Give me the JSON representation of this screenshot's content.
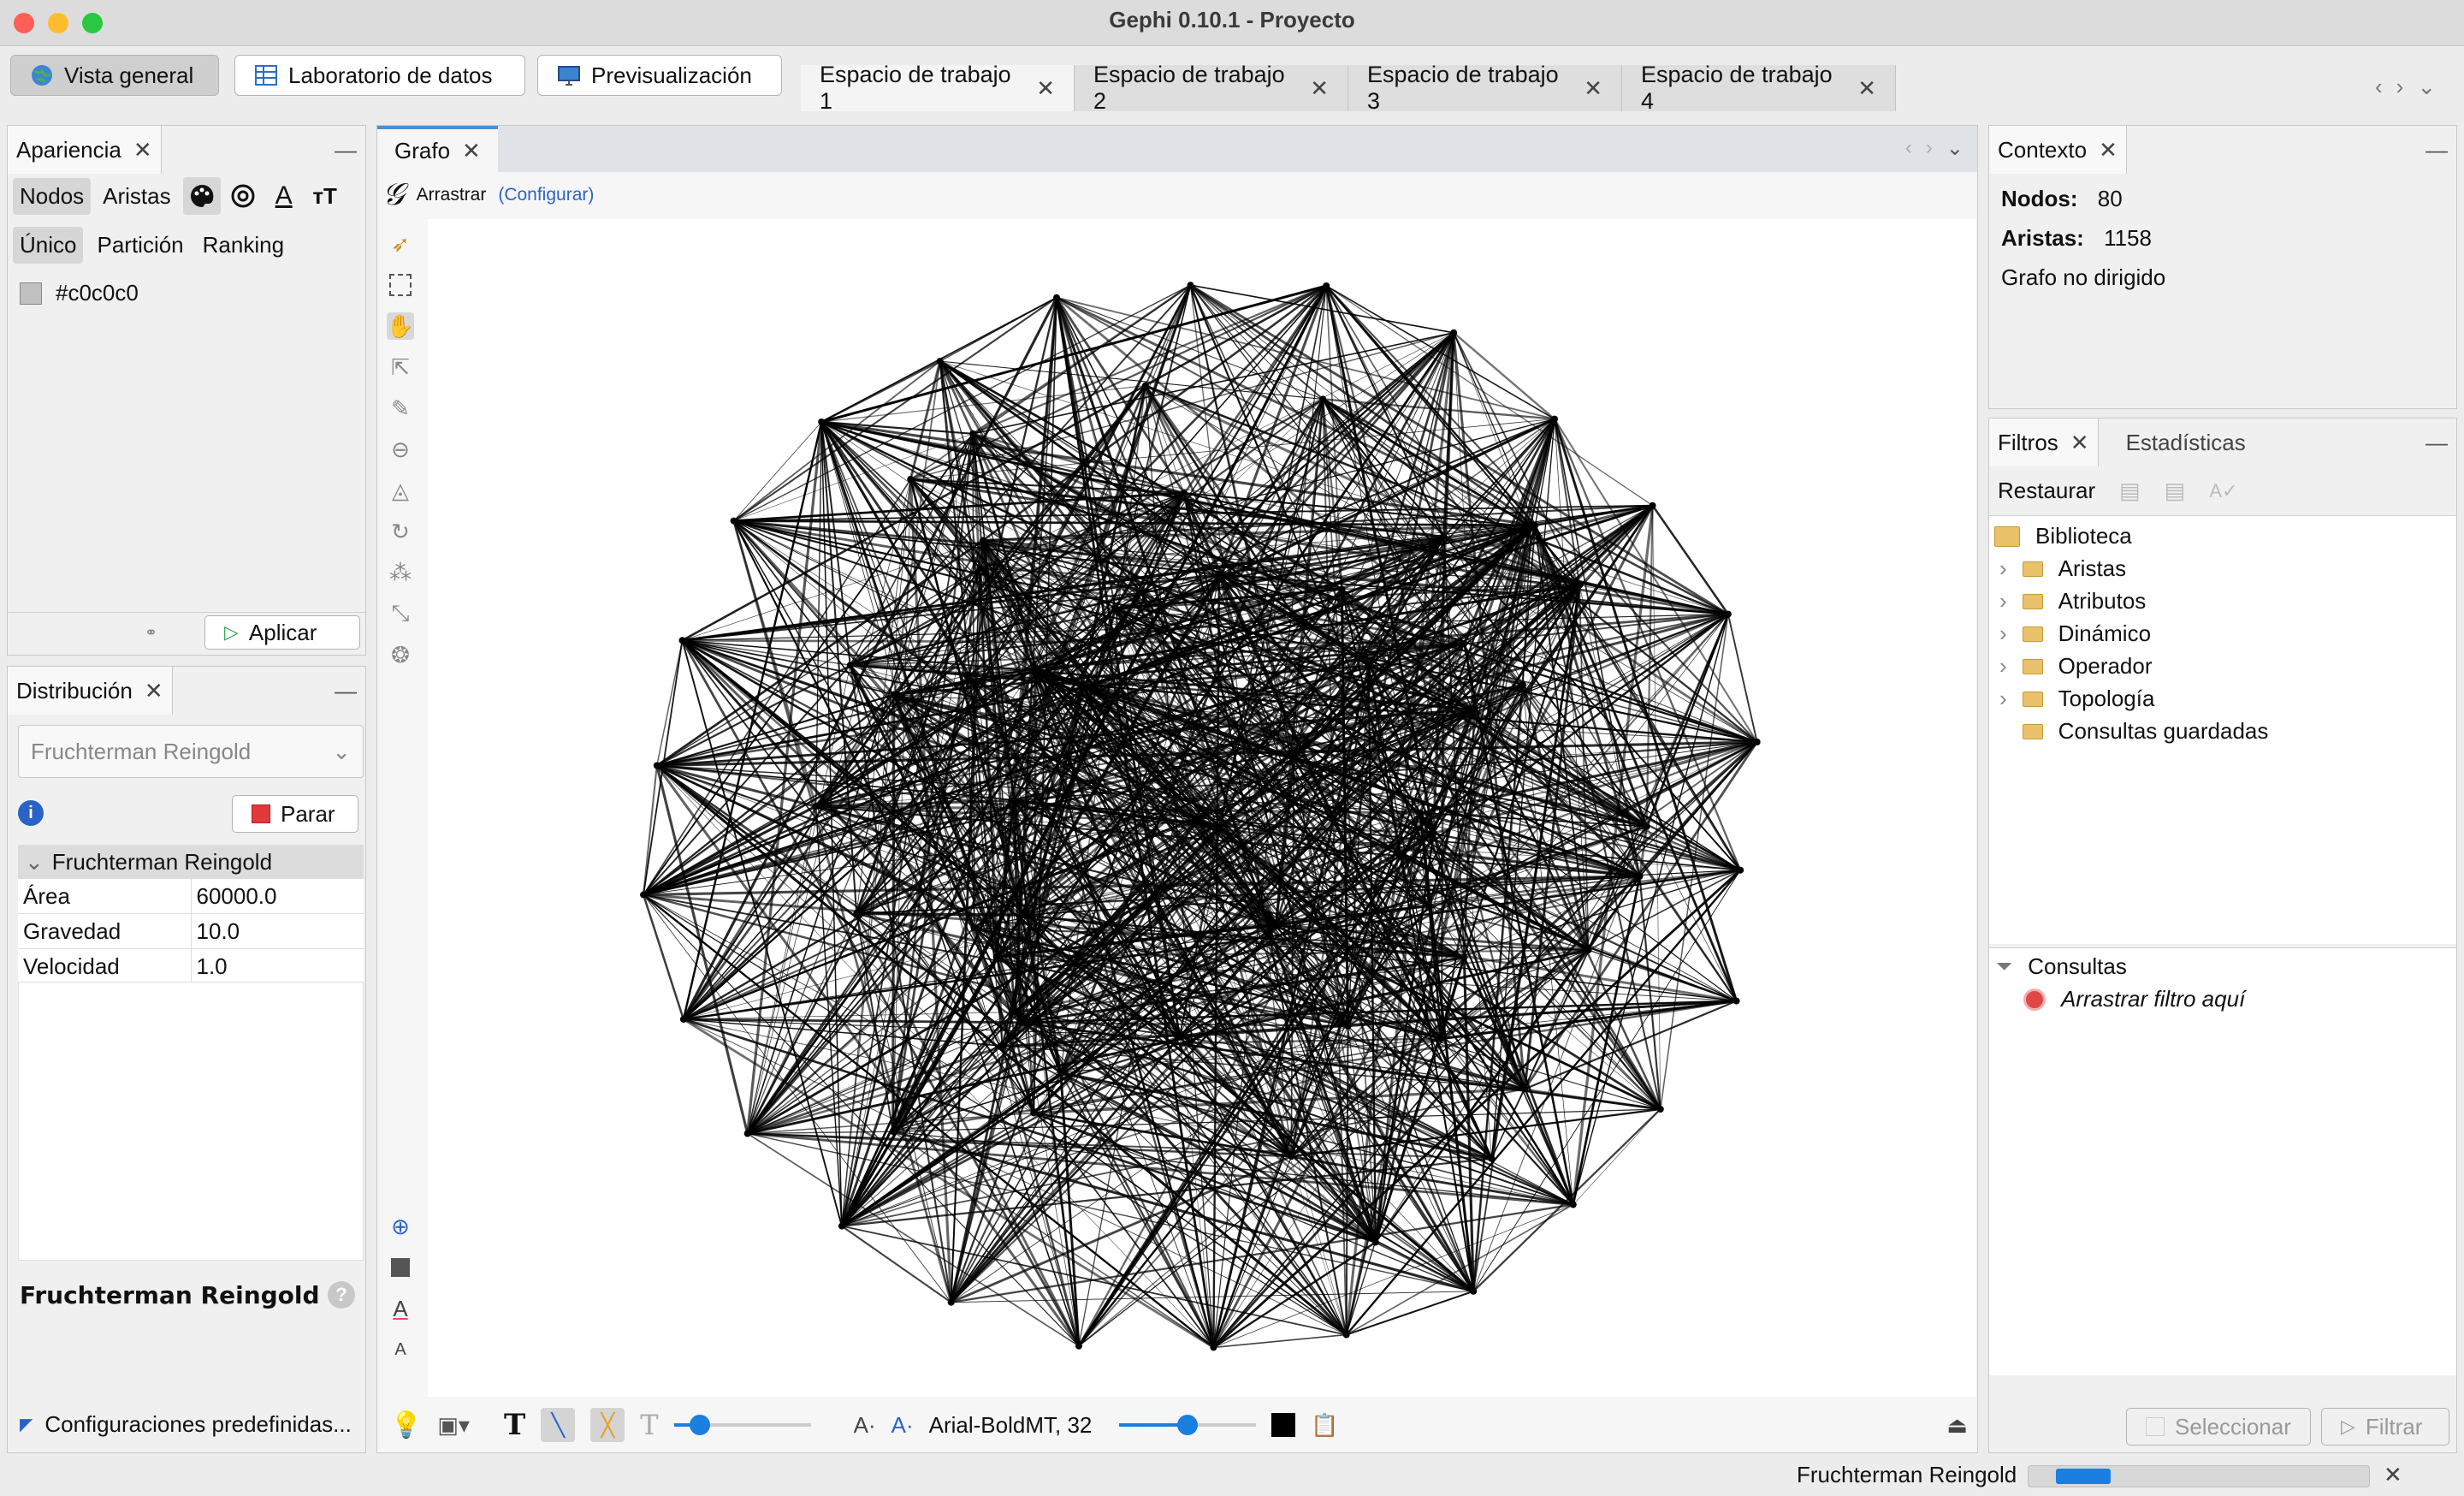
{
  "window": {
    "title": "Gephi 0.10.1 - Proyecto"
  },
  "modes": [
    {
      "label": "Vista general",
      "icon": "globe-icon"
    },
    {
      "label": "Laboratorio de datos",
      "icon": "table-icon"
    },
    {
      "label": "Previsualización",
      "icon": "monitor-icon"
    }
  ],
  "workspaces": [
    "Espacio de trabajo 1",
    "Espacio de trabajo 2",
    "Espacio de trabajo 3",
    "Espacio de trabajo 4"
  ],
  "appearance": {
    "title": "Apariencia",
    "target_tabs": [
      "Nodos",
      "Aristas"
    ],
    "mode_tabs": [
      "Único",
      "Partición",
      "Ranking"
    ],
    "color_value": "#c0c0c0",
    "apply_label": "Aplicar"
  },
  "layout": {
    "title": "Distribución",
    "algorithm": "Fruchterman Reingold",
    "stop_label": "Parar",
    "section": "Fruchterman Reingold",
    "properties": [
      {
        "name": "Área",
        "value": "60000.0"
      },
      {
        "name": "Gravedad",
        "value": "10.0"
      },
      {
        "name": "Velocidad",
        "value": "1.0"
      }
    ],
    "description_title": "Fruchterman Reingold",
    "presets_label": "Configuraciones predefinidas..."
  },
  "graph": {
    "tab": "Grafo",
    "tool_label": "Arrastrar",
    "configure_label": "(Configurar)",
    "font_label": "Arial-BoldMT, 32",
    "node_color": "#000000",
    "node_count": 80
  },
  "context": {
    "title": "Contexto",
    "nodes_label": "Nodos:",
    "nodes_value": "80",
    "edges_label": "Aristas:",
    "edges_value": "1158",
    "graph_type": "Grafo no dirigido"
  },
  "filters": {
    "tabs": [
      "Filtros",
      "Estadísticas"
    ],
    "reset_label": "Restaurar",
    "library_label": "Biblioteca",
    "library_items": [
      "Aristas",
      "Atributos",
      "Dinámico",
      "Operador",
      "Topología",
      "Consultas guardadas"
    ],
    "queries_label": "Consultas",
    "drop_hint": "Arrastrar filtro aquí",
    "select_label": "Seleccionar",
    "filter_label": "Filtrar"
  },
  "status": {
    "task": "Fruchterman Reingold",
    "progress": 0.2
  },
  "colors": {
    "accent": "#1a7fe0",
    "edge": "#000000"
  }
}
